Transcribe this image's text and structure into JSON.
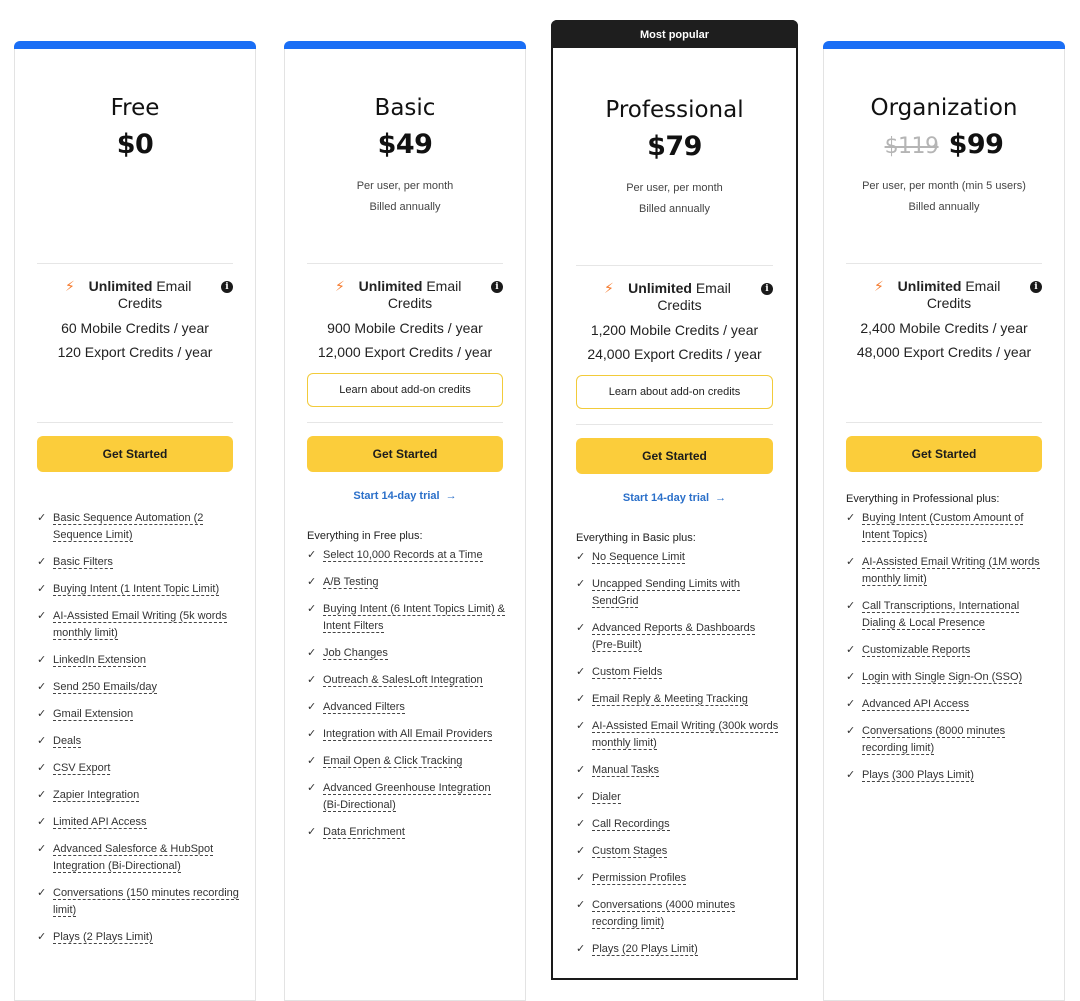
{
  "plans": [
    {
      "name": "Free",
      "price": "$0",
      "old_price": "",
      "per": "",
      "billed": "",
      "unlimited_bold": "Unlimited",
      "unlimited_rest": " Email Credits",
      "mobile_credits": "60 Mobile Credits / year",
      "export_credits": "120 Export Credits / year",
      "addon_label": "",
      "cta": "Get Started",
      "trial": "",
      "features_heading": "",
      "features": [
        "Basic Sequence Automation (2 Sequence Limit)",
        "Basic Filters",
        "Buying Intent (1 Intent Topic Limit)",
        "AI-Assisted Email Writing (5k words monthly limit)",
        "LinkedIn Extension",
        "Send 250 Emails/day",
        "Gmail Extension",
        "Deals",
        "CSV Export",
        "Zapier Integration",
        "Limited API Access",
        "Advanced Salesforce & HubSpot Integration (Bi-Directional)",
        "Conversations (150 minutes recording limit)",
        "Plays (2 Plays Limit)"
      ]
    },
    {
      "name": "Basic",
      "price": "$49",
      "old_price": "",
      "per": "Per user, per month",
      "billed": "Billed annually",
      "unlimited_bold": "Unlimited",
      "unlimited_rest": " Email Credits",
      "mobile_credits": "900 Mobile Credits / year",
      "export_credits": "12,000 Export Credits / year",
      "addon_label": "Learn about add-on credits",
      "cta": "Get Started",
      "trial": "Start 14-day trial",
      "features_heading": "Everything in Free plus:",
      "features": [
        "Select 10,000 Records at a Time",
        "A/B Testing",
        "Buying Intent (6 Intent Topics Limit) & Intent Filters",
        "Job Changes",
        "Outreach & SalesLoft Integration",
        "Advanced Filters",
        "Integration with All Email Providers",
        "Email Open & Click Tracking",
        "Advanced Greenhouse Integration (Bi-Directional)",
        "Data Enrichment"
      ]
    },
    {
      "name": "Professional",
      "badge": "Most popular",
      "price": "$79",
      "old_price": "",
      "per": "Per user, per month",
      "billed": "Billed annually",
      "unlimited_bold": "Unlimited",
      "unlimited_rest": " Email Credits",
      "mobile_credits": "1,200 Mobile Credits / year",
      "export_credits": "24,000 Export Credits / year",
      "addon_label": "Learn about add-on credits",
      "cta": "Get Started",
      "trial": "Start 14-day trial",
      "features_heading": "Everything in Basic plus:",
      "features": [
        "No Sequence Limit",
        "Uncapped Sending Limits with SendGrid",
        "Advanced Reports & Dashboards (Pre-Built)",
        "Custom Fields",
        "Email Reply & Meeting Tracking",
        "AI-Assisted Email Writing (300k words monthly limit)",
        "Manual Tasks",
        "Dialer",
        "Call Recordings",
        "Custom Stages",
        "Permission Profiles",
        "Conversations (4000 minutes recording limit)",
        "Plays (20 Plays Limit)"
      ]
    },
    {
      "name": "Organization",
      "price": "$99",
      "old_price": "$119",
      "per": "Per user, per month (min 5 users)",
      "billed": "Billed annually",
      "unlimited_bold": "Unlimited",
      "unlimited_rest": " Email Credits",
      "mobile_credits": "2,400 Mobile Credits / year",
      "export_credits": "48,000 Export Credits / year",
      "addon_label": "",
      "cta": "Get Started",
      "trial": "",
      "features_heading": "Everything in Professional plus:",
      "features": [
        "Buying Intent (Custom Amount of Intent Topics)",
        "AI-Assisted Email Writing (1M words monthly limit)",
        "Call Transcriptions, International Dialing & Local Presence",
        "Customizable Reports",
        "Login with Single Sign-On (SSO)",
        "Advanced API Access",
        "Conversations (8000 minutes recording limit)",
        "Plays (300 Plays Limit)"
      ]
    }
  ],
  "icons": {
    "bolt": "⚡",
    "info": "i",
    "check": "✓",
    "arrow": "→"
  },
  "colors": {
    "accent_blue": "#1a6ef5",
    "cta_yellow": "#fbcd3b",
    "bolt_orange": "#f57a2d",
    "link_blue": "#2a6fc9",
    "popular_black": "#1e1e1e"
  }
}
